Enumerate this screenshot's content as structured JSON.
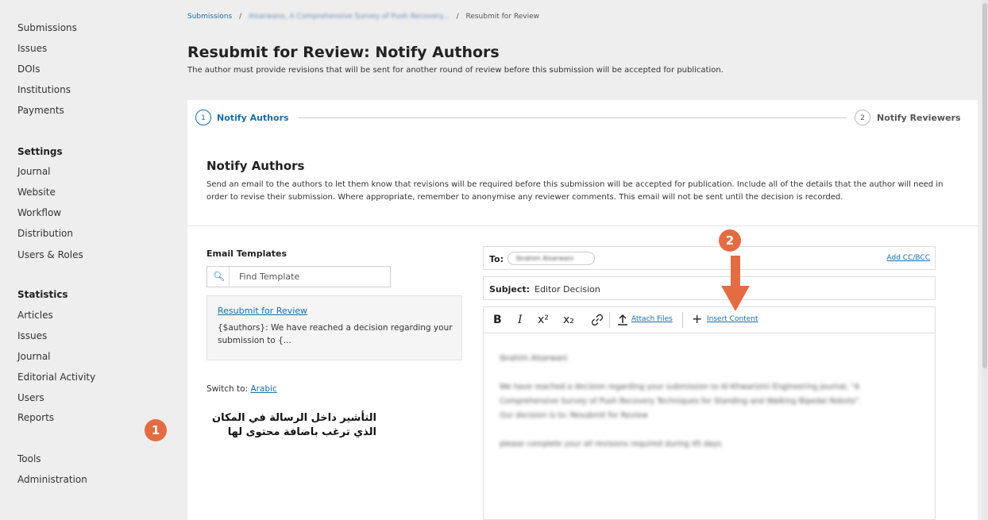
{
  "sidebar": {
    "items_top": [
      "Submissions",
      "Issues",
      "DOIs",
      "Institutions",
      "Payments"
    ],
    "settings_heading": "Settings",
    "settings_items": [
      "Journal",
      "Website",
      "Workflow",
      "Distribution",
      "Users & Roles"
    ],
    "statistics_heading": "Statistics",
    "statistics_items": [
      "Articles",
      "Issues",
      "Journal",
      "Editorial Activity",
      "Users",
      "Reports"
    ],
    "items_bottom": [
      "Tools",
      "Administration"
    ]
  },
  "breadcrumb": {
    "home": "Submissions",
    "separator": "/",
    "article": "Alsarwans, A Comprehensive Survey of Push Recovery...",
    "current": "Resubmit for Review"
  },
  "page": {
    "title": "Resubmit for Review: Notify Authors",
    "subtitle": "The author must provide revisions that will be sent for another round of review before this submission will be accepted for publication."
  },
  "steps": [
    {
      "number": "1",
      "label": "Notify Authors"
    },
    {
      "number": "2",
      "label": "Notify Reviewers"
    }
  ],
  "notify": {
    "heading": "Notify Authors",
    "description": "Send an email to the authors to let them know that revisions will be required before this submission will be accepted for publication. Include all of the details that the author will need in order to revise their submission. Where appropriate, remember to anonymise any reviewer comments. This email will not be sent until the decision is recorded."
  },
  "templates": {
    "heading": "Email Templates",
    "search_placeholder": "Find Template",
    "item_title": "Resubmit for Review",
    "item_preview": "{$authors}: We have reached a decision regarding your submission to {...",
    "switch_label": "Switch to:",
    "switch_language": "Arabic"
  },
  "email": {
    "to_label": "To:",
    "recipient": "Ibrahim Alsarwani",
    "add_cc_bcc": "Add CC/BCC",
    "subject_label": "Subject:",
    "subject_value": "Editor Decision",
    "toolbar": {
      "bold": "B",
      "italic": "I",
      "superscript": "x²",
      "subscript": "x₂",
      "attach_files": "Attach Files",
      "insert_content": "Insert Content"
    },
    "body_lines": [
      "Ibrahim Alsarwani",
      "We have reached a decision regarding your submission to Al-Khwarizmi Engineering Journal, \"A",
      "Comprehensive Survey of Push Recovery Techniques for Standing and Walking Bipedal Robots\".",
      "Our decision is to: Resubmit for Review",
      "please complete your all revisions required during 45 days"
    ]
  },
  "annotations": {
    "badge1": "1",
    "badge2": "2",
    "text1": "التأشير داخل الرسالة في المكان الذي ترغب باضافة محتوى لها",
    "accent_color": "#e46c43"
  }
}
